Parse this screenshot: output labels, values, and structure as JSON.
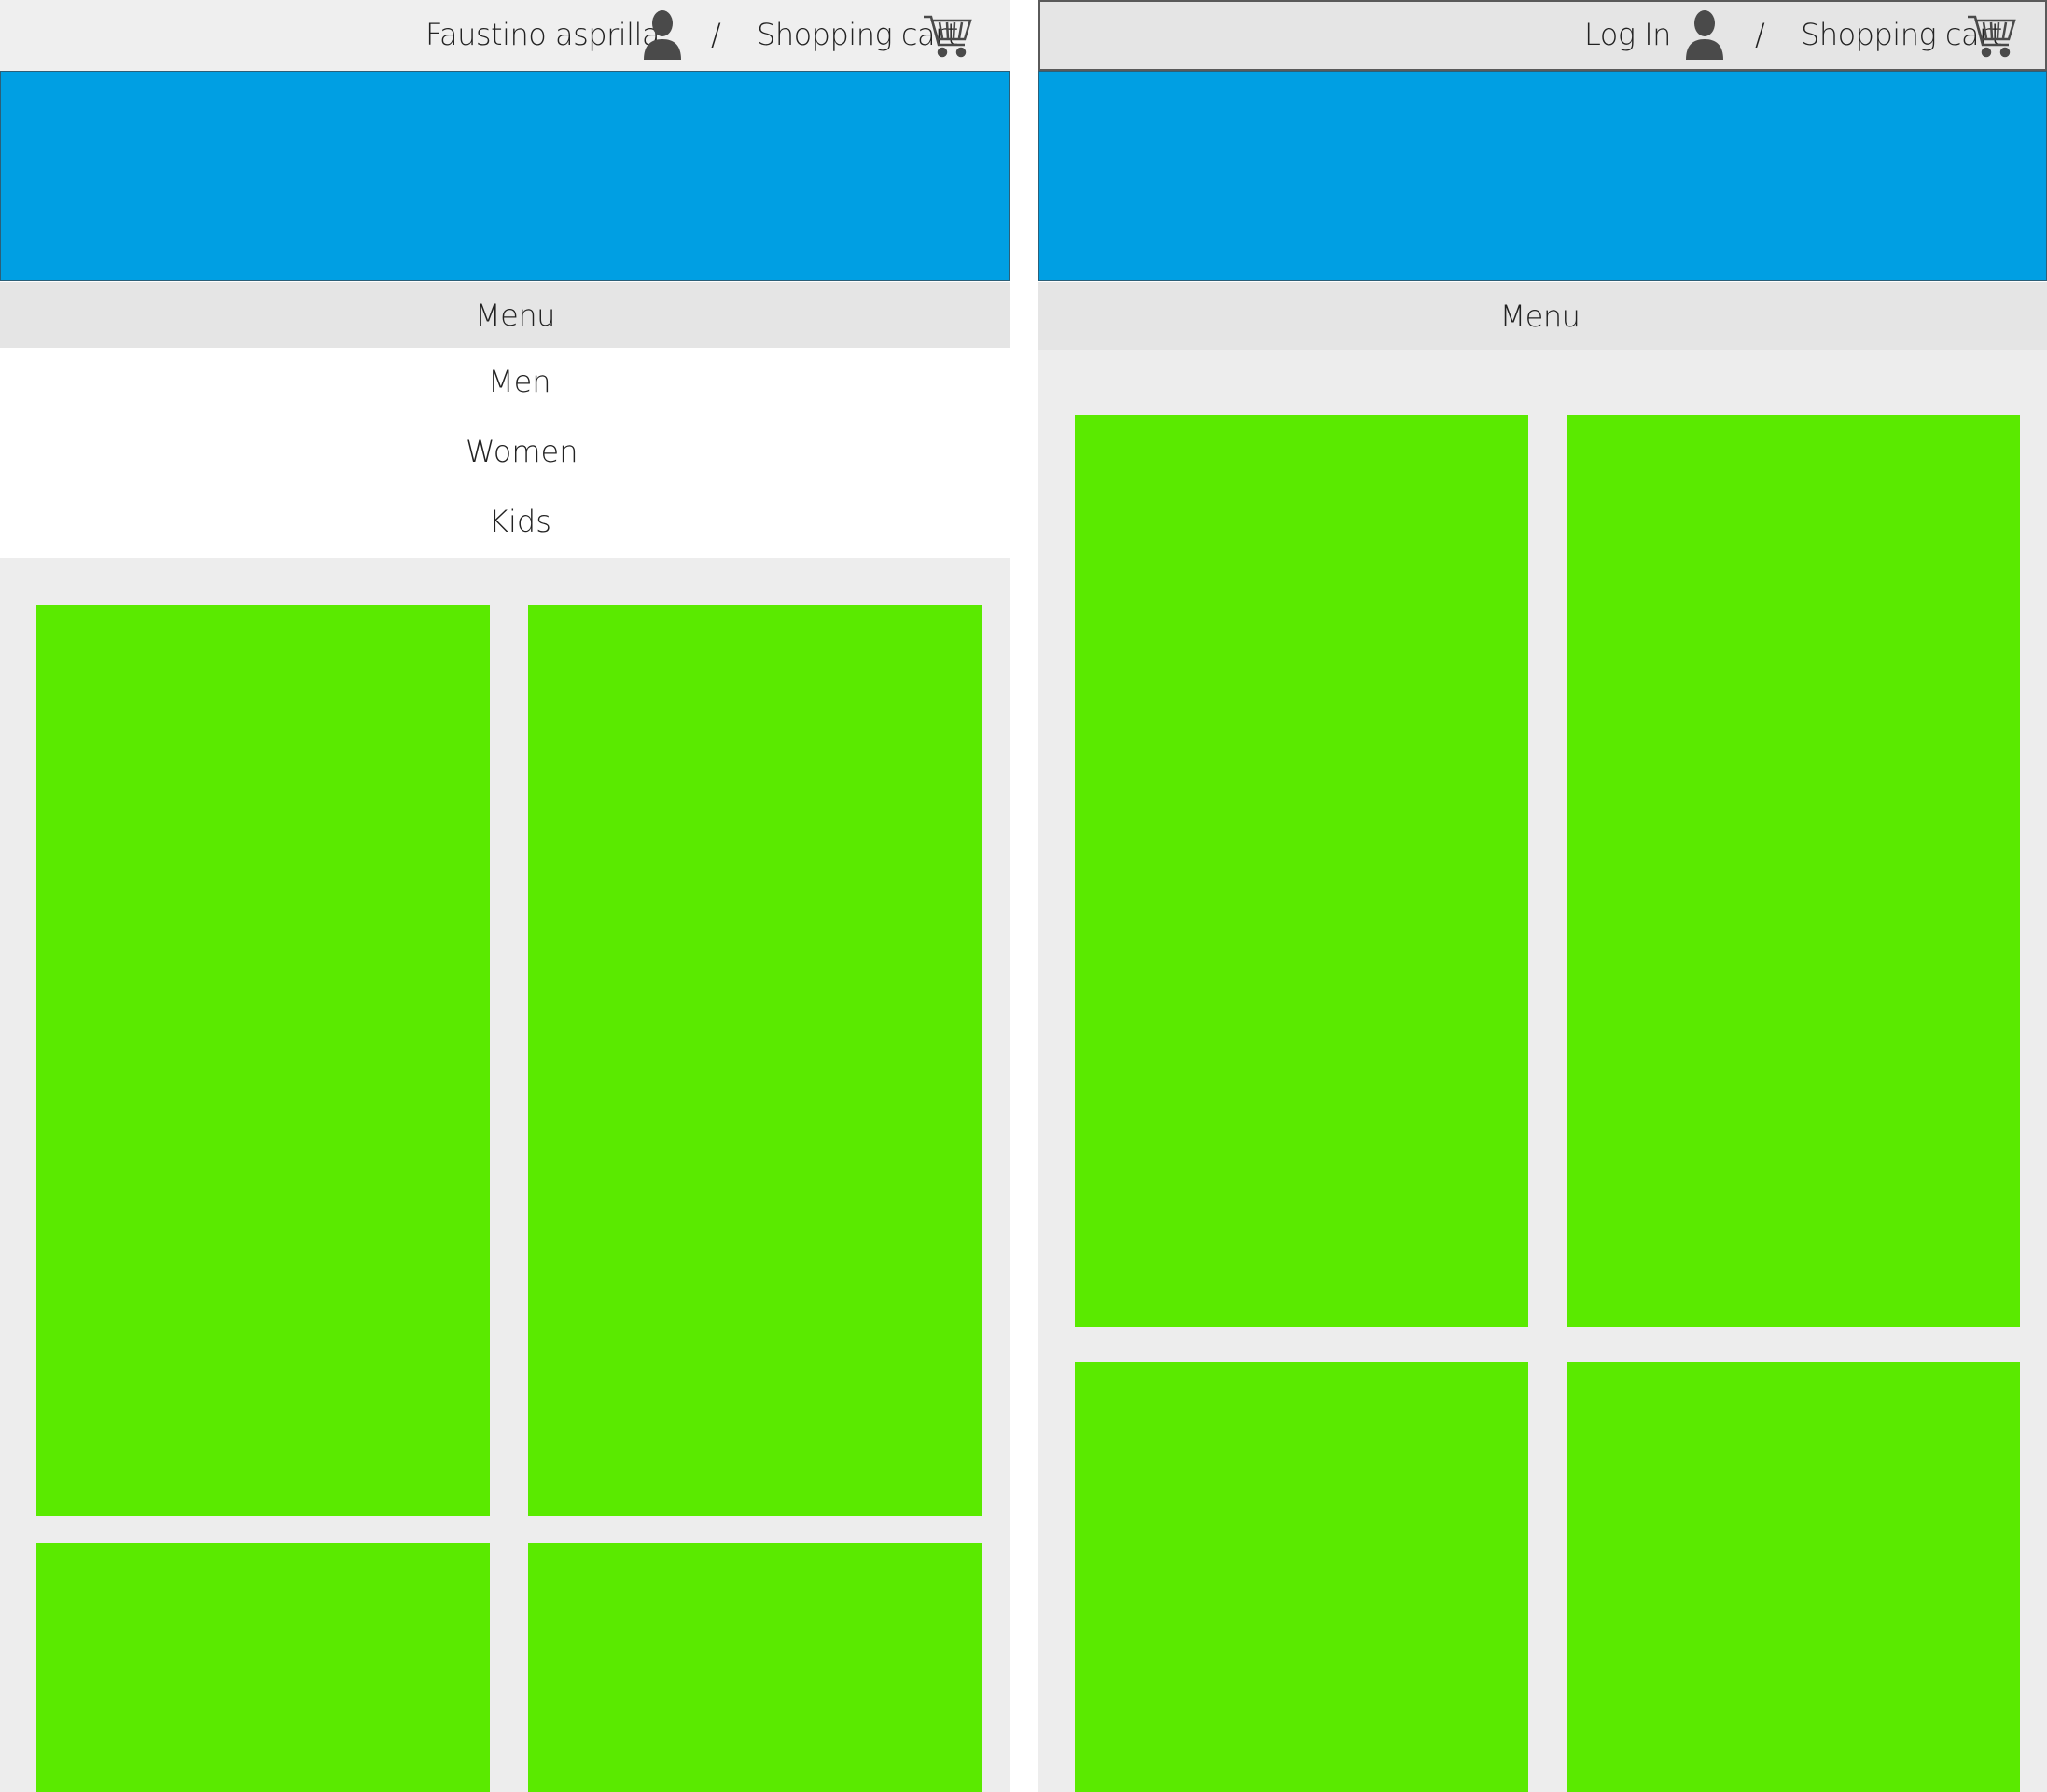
{
  "colors": {
    "accent": "#009fe3",
    "tile": "#5aea00",
    "topbar": "#efefef",
    "menubar": "#e5e5e5",
    "content_bg": "#ededed",
    "icon": "#4a4a4a"
  },
  "panels": [
    {
      "header": {
        "user_label": "Faustino asprilla",
        "user_icon": "user-icon",
        "separator": "/",
        "cart_label": "Shopping cart",
        "cart_icon": "shopping-cart-icon"
      },
      "menu": {
        "label": "Menu",
        "items": [
          {
            "label": "Men"
          },
          {
            "label": "Women"
          },
          {
            "label": "Kids"
          }
        ]
      }
    },
    {
      "header": {
        "user_label": "Log In",
        "user_icon": "user-icon",
        "separator": "/",
        "cart_label": "Shopping cart",
        "cart_icon": "shopping-cart-icon"
      },
      "menu": {
        "label": "Menu"
      }
    }
  ]
}
